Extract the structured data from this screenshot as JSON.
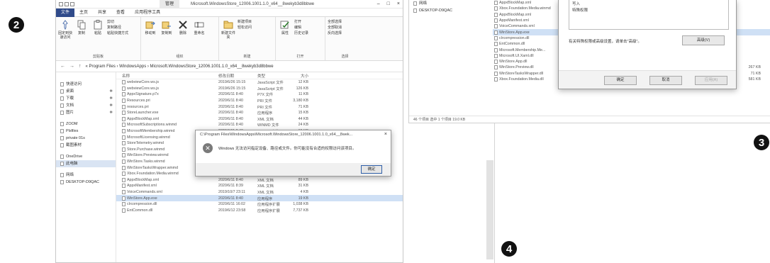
{
  "steps": {
    "s2": "2",
    "s3": "3",
    "s4": "4"
  },
  "win2": {
    "title_tab": "管理",
    "title_path": "Microsoft.WindowsStore_12006.1001.1.0_x64__8wekyb3d8bbwe",
    "controls": [
      "–",
      "□",
      "×"
    ],
    "tabs": [
      "文件",
      "主页",
      "共享",
      "查看",
      "应用程序工具"
    ],
    "ribbon": {
      "clipboard": {
        "label": "剪贴板",
        "buttons": [
          "固定到快速访问",
          "复制",
          "粘贴"
        ],
        "small": [
          "剪切",
          "复制路径",
          "粘贴快捷方式"
        ]
      },
      "organize": {
        "label": "组织",
        "buttons": [
          "移动到",
          "复制到",
          "删除",
          "重命名"
        ]
      },
      "new": {
        "label": "新建",
        "buttons": [
          "新建文件夹"
        ],
        "small": [
          "新建项目",
          "轻松访问"
        ]
      },
      "open": {
        "label": "打开",
        "buttons": [
          "属性"
        ],
        "small": [
          "打开",
          "编辑",
          "历史记录"
        ]
      },
      "select": {
        "label": "选择",
        "small": [
          "全部选择",
          "全部取消",
          "反向选择"
        ]
      }
    },
    "address": "« Program Files › WindowsApps › Microsoft.WindowsStore_12006.1001.1.0_x64__8wekyb3d8bbwe",
    "nav": [
      {
        "label": "快速访问",
        "pin": ""
      },
      {
        "label": "桌面",
        "pin": "✱"
      },
      {
        "label": "下载",
        "pin": "✱"
      },
      {
        "label": "文档",
        "pin": "✱"
      },
      {
        "label": "图片",
        "pin": "✱"
      },
      {
        "label": "ZOOM",
        "pin": ""
      },
      {
        "label": "Plsfiles",
        "pin": ""
      },
      {
        "label": "private 01s",
        "pin": ""
      },
      {
        "label": "截图素材",
        "pin": ""
      },
      {
        "label": "OneDrive",
        "pin": ""
      },
      {
        "label": "此电脑",
        "pin": ""
      },
      {
        "label": "网络",
        "pin": ""
      },
      {
        "label": "DESKTOP-D9QAC",
        "pin": ""
      }
    ],
    "columns": [
      "名称",
      "修改日期",
      "类型",
      "大小"
    ],
    "files": [
      {
        "name": "webviewCore.ws.js",
        "date": "2019/6/26 15:15",
        "type": "JavaScript 文件",
        "size": "12 KB"
      },
      {
        "name": "webviewCore.ws.js",
        "date": "2019/6/26 15:15",
        "type": "JavaScript 文件",
        "size": "126 KB"
      },
      {
        "name": "AppxSignature.p7x",
        "date": "2020/6/11 8:40",
        "type": "P7X 文件",
        "size": "11 KB"
      },
      {
        "name": "Resources.pri",
        "date": "2020/6/11 8:40",
        "type": "PRI 文件",
        "size": "3,180 KB"
      },
      {
        "name": "resources.pri",
        "date": "2020/6/11 8:40",
        "type": "PRI 文件",
        "size": "71 KB"
      },
      {
        "name": "StoreLauncher.exe",
        "date": "2020/6/11 8:40",
        "type": "应用程序",
        "size": "15 KB"
      },
      {
        "name": "AppxBlockMap.xml",
        "date": "2020/6/11 8:40",
        "type": "XML 文档",
        "size": "44 KB"
      },
      {
        "name": "MicrosoftSubscriptions.winmd",
        "date": "2020/6/11 8:40",
        "type": "WINMD 文件",
        "size": "24 KB"
      },
      {
        "name": "MicrosoftMembership.winmd",
        "date": "2020/6/11 8:40",
        "type": "WINMD 文件",
        "size": "19 KB"
      },
      {
        "name": "MicrosoftLicensing.winmd",
        "date": "2020/6/11 8:40",
        "type": "WINMD 文件",
        "size": "31 KB"
      },
      {
        "name": "StoreTelemetry.winmd",
        "date": "2020/6/11 8:40",
        "type": "WINMD 文件",
        "size": "11 KB"
      },
      {
        "name": "Store.Purchase.winmd",
        "date": "2020/6/11 8:40",
        "type": "WINMD 文件",
        "size": "18 KB"
      },
      {
        "name": "WinStore.Preview.winmd",
        "date": "2020/6/11 8:40",
        "type": "WINMD 文件",
        "size": "73 KB"
      },
      {
        "name": "WinStore.Tasks.winmd",
        "date": "2020/6/11 8:40",
        "type": "WINMD 文件",
        "size": "81 KB"
      },
      {
        "name": "WinStoreTasksWrapper.winmd",
        "date": "2020/6/11 8:40",
        "type": "WINMD 文件",
        "size": "4 KB"
      },
      {
        "name": "Xbox.Foundation.Media.winmd",
        "date": "2019/6/12 23:58",
        "type": "WINMD 文件",
        "size": "8 KB"
      },
      {
        "name": "AppxBlockMap.xml",
        "date": "2020/6/11 8:40",
        "type": "XML 文档",
        "size": "89 KB"
      },
      {
        "name": "AppxManifest.xml",
        "date": "2020/6/11 8:39",
        "type": "XML 文档",
        "size": "31 KB"
      },
      {
        "name": "VoiceCommands.xml",
        "date": "2019/10/7 23:11",
        "type": "XML 文档",
        "size": "4 KB"
      },
      {
        "name": "WinStore.App.exe",
        "date": "2020/6/11 8:40",
        "type": "应用程序",
        "size": "19 KB",
        "selected": true
      },
      {
        "name": "clrcompression.dll",
        "date": "2020/6/11 16:02",
        "type": "应用程序扩展",
        "size": "1,038 KB"
      },
      {
        "name": "EntCommon.dll",
        "date": "2019/6/12 23:58",
        "type": "应用程序扩展",
        "size": "7,737 KB"
      }
    ],
    "dialog": {
      "title": "C:\\Program Files\\WindowsApps\\Microsoft.WindowsStore_12006.1001.1.0_x64__8wek...",
      "message": "Windows 无法访问指定设备、路径或文件。你可能没有合适的权限访问该项目。",
      "ok": "确定",
      "close": "×"
    }
  },
  "win3": {
    "nav": [
      {
        "label": "网络"
      },
      {
        "label": "DESKTOP-D9QAC"
      }
    ],
    "files_top": [
      {
        "name": "AppxBlockMap.xml"
      },
      {
        "name": "Xbox.Foundation.Media.winmd"
      },
      {
        "name": "AppxBlockMap.xml"
      },
      {
        "name": "AppxManifest.xml"
      },
      {
        "name": "VoiceCommands.xml"
      },
      {
        "name": "WinStore.App.exe",
        "selected": true
      },
      {
        "name": "clrcompression.dll"
      },
      {
        "name": "EntCommon.dll"
      },
      {
        "name": "Microsoft.Membership.Me..."
      },
      {
        "name": "Microsoft.UI.Xaml.dll"
      }
    ],
    "files_bottom": [
      {
        "name": "WinStore.App.dll",
        "date": "",
        "type": "",
        "size": ""
      },
      {
        "name": "WinStore.Preview.dll",
        "date": "2020/6/11 0:40",
        "type": "应用程序扩展",
        "size": "267 KB"
      },
      {
        "name": "WinStoreTasksWrapper.dll",
        "date": "2020/6/11 0:40",
        "type": "应用程序扩展",
        "size": "71 KB"
      },
      {
        "name": "Xbox.Foundation.Media.dll",
        "date": "2019/6/12 23:58",
        "type": "应用程序扩展",
        "size": "581 KB"
      }
    ],
    "status": "46 个项目    选中 1 个项目  19.0 KB"
  },
  "props": {
    "list": [
      "",
      "写入",
      "特殊权限"
    ],
    "note": "有关特殊权限或高级设置，请单击\"高级\"。",
    "advanced": "高级(V)",
    "ok": "确定",
    "cancel": "取消",
    "apply": "应用(A)"
  }
}
